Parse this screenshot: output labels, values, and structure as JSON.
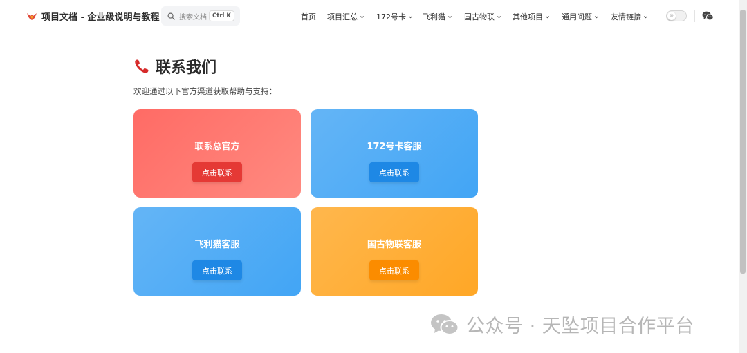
{
  "header": {
    "brand_title": "项目文档 - 企业级说明与教程",
    "search_placeholder": "搜索文档",
    "search_shortcut": "Ctrl K",
    "nav_items": [
      {
        "label": "首页",
        "has_dropdown": false
      },
      {
        "label": "项目汇总",
        "has_dropdown": true
      },
      {
        "label": "172号卡",
        "has_dropdown": true
      },
      {
        "label": "飞利猫",
        "has_dropdown": true
      },
      {
        "label": "国古物联",
        "has_dropdown": true
      },
      {
        "label": "其他项目",
        "has_dropdown": true
      },
      {
        "label": "通用问题",
        "has_dropdown": true
      },
      {
        "label": "友情链接",
        "has_dropdown": true
      }
    ],
    "theme_toggle_icon": "☼"
  },
  "main": {
    "title": "联系我们",
    "intro": "欢迎通过以下官方渠道获取帮助与支持：",
    "cards": [
      {
        "title": "联系总官方",
        "button_label": "点击联系",
        "gradient_from": "#ff6b65",
        "gradient_to": "#ff8a80",
        "button_color": "#e53935"
      },
      {
        "title": "172号卡客服",
        "button_label": "点击联系",
        "gradient_from": "#64b5f6",
        "gradient_to": "#42a5f5",
        "button_color": "#1e88e5"
      },
      {
        "title": "飞利猫客服",
        "button_label": "点击联系",
        "gradient_from": "#64b5f6",
        "gradient_to": "#42a5f5",
        "button_color": "#1e88e5"
      },
      {
        "title": "国古物联客服",
        "button_label": "点击联系",
        "gradient_from": "#ffb74d",
        "gradient_to": "#ffa726",
        "button_color": "#fb8c00"
      }
    ]
  },
  "watermark": {
    "text": "公众号 · 天坠项目合作平台"
  }
}
